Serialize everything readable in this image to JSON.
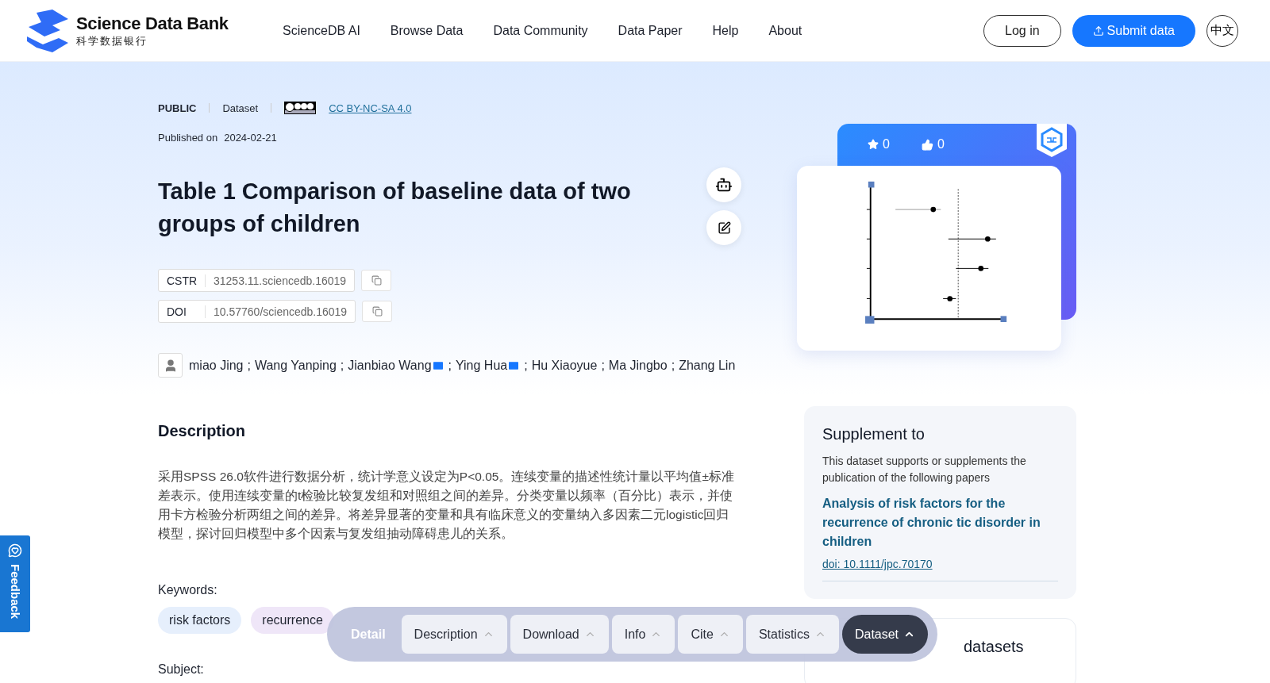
{
  "header": {
    "logo_title": "Science Data Bank",
    "logo_subtitle": "科学数据银行",
    "nav": [
      "ScienceDB AI",
      "Browse Data",
      "Data Community",
      "Data Paper",
      "Help",
      "About"
    ],
    "login": "Log in",
    "submit": "Submit data",
    "language": "中文"
  },
  "meta": {
    "access": "PUBLIC",
    "type": "Dataset",
    "license": "CC BY-NC-SA 4.0",
    "published_label": "Published on",
    "published_date": "2024-02-21"
  },
  "title": "Table 1 Comparison of baseline data of two groups of children",
  "identifiers": [
    {
      "label": "CSTR",
      "value": "31253.11.sciencedb.16019"
    },
    {
      "label": "DOI",
      "value": "10.57760/sciencedb.16019"
    }
  ],
  "authors": [
    {
      "name": "miao Jing",
      "email": false,
      "separator": ";"
    },
    {
      "name": "Wang Yanping",
      "email": false,
      "separator": ";"
    },
    {
      "name": "Jianbiao Wang",
      "email": true,
      "separator": ";"
    },
    {
      "name": "Ying Hua",
      "email": true,
      "separator": ";"
    },
    {
      "name": "Hu Xiaoyue",
      "email": false,
      "separator": ";"
    },
    {
      "name": "Ma Jingbo",
      "email": false,
      "separator": ";"
    },
    {
      "name": "Zhang Lin",
      "email": false
    }
  ],
  "description": {
    "heading": "Description",
    "text": "采用SPSS 26.0软件进行数据分析，统计学意义设定为P<0.05。连续变量的描述性统计量以平均值±标准差表示。使用连续变量的t检验比较复发组和对照组之间的差异。分类变量以频率（百分比）表示，并使用卡方检验分析两组之间的差异。将差异显著的变量和具有临床意义的变量纳入多因素二元logistic回归模型，探讨回归模型中多个因素与复发组抽动障碍患儿的关系。"
  },
  "keywords": {
    "label": "Keywords:",
    "items": [
      {
        "text": "risk factors",
        "color": "#e6effc"
      },
      {
        "text": "recurrence",
        "color": "#efe6f8"
      }
    ]
  },
  "subject_label": "Subject:",
  "stats": {
    "favorites": "0",
    "likes": "0"
  },
  "supplement": {
    "heading": "Supplement to",
    "intro": "This dataset supports or supplements the publication of the following papers",
    "paper_title": "Analysis of risk factors for the recurrence of chronic tic disorder in children",
    "paper_doi": "doi: 10.1111/jpc.70170"
  },
  "related_heading": "datasets",
  "bottom_nav": [
    {
      "label": "Detail",
      "selected": false,
      "kind": "plain"
    },
    {
      "label": "Description",
      "selected": false,
      "kind": "menu"
    },
    {
      "label": "Download",
      "selected": false,
      "kind": "menu"
    },
    {
      "label": "Info",
      "selected": false,
      "kind": "menu"
    },
    {
      "label": "Cite",
      "selected": false,
      "kind": "menu"
    },
    {
      "label": "Statistics",
      "selected": false,
      "kind": "menu"
    },
    {
      "label": "Dataset",
      "selected": true,
      "kind": "menu"
    }
  ],
  "feedback": "Feedback"
}
